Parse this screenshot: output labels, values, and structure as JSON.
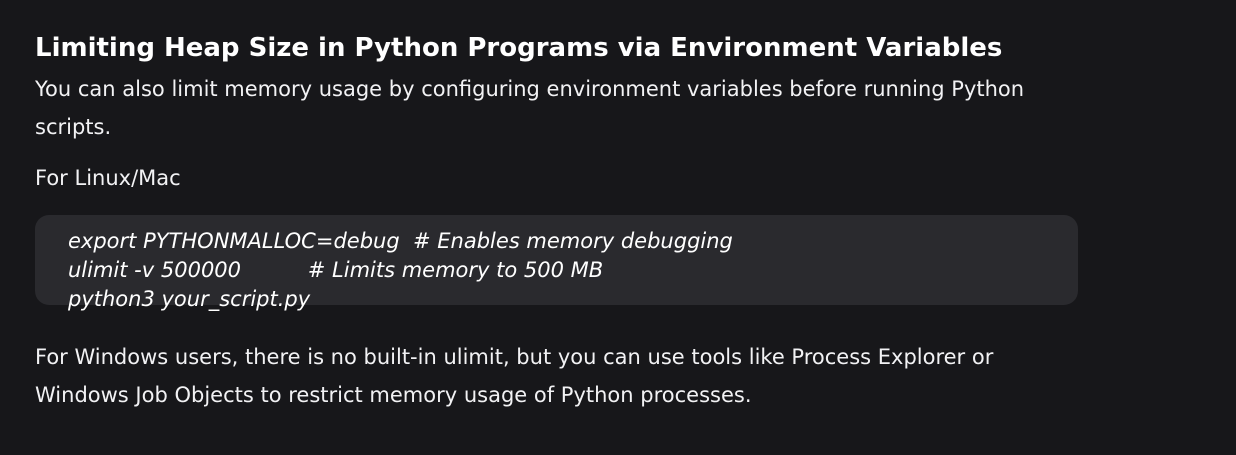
{
  "article": {
    "heading": "Limiting Heap Size in Python Programs via Environment Variables",
    "intro": "You can also limit memory usage by configuring environment variables before running Python scripts.",
    "platform_label": "For Linux/Mac",
    "code_lines": [
      "export PYTHONMALLOC=debug  # Enables memory debugging",
      "ulimit -v 500000          # Limits memory to 500 MB",
      "python3 your_script.py"
    ],
    "windows_note": "For Windows users, there is no built-in ulimit, but you can use tools like Process Explorer or Windows Job Objects to restrict memory usage of Python processes."
  }
}
